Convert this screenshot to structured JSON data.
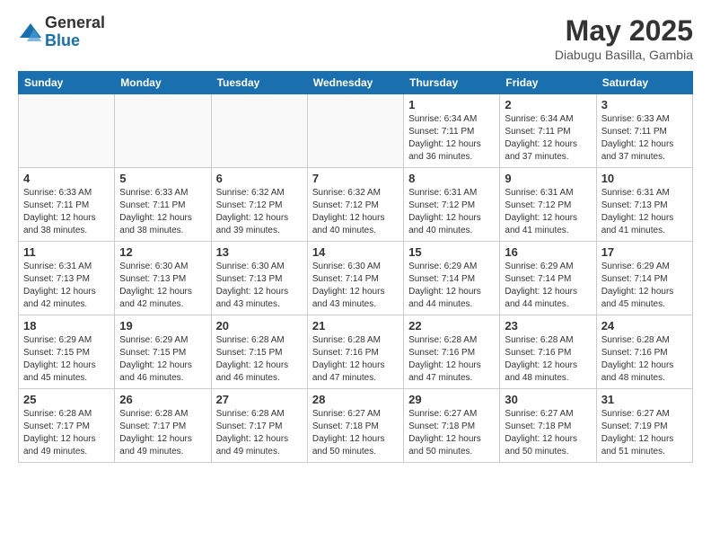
{
  "logo": {
    "general": "General",
    "blue": "Blue"
  },
  "header": {
    "month": "May 2025",
    "location": "Diabugu Basilla, Gambia"
  },
  "weekdays": [
    "Sunday",
    "Monday",
    "Tuesday",
    "Wednesday",
    "Thursday",
    "Friday",
    "Saturday"
  ],
  "weeks": [
    [
      {
        "day": "",
        "info": ""
      },
      {
        "day": "",
        "info": ""
      },
      {
        "day": "",
        "info": ""
      },
      {
        "day": "",
        "info": ""
      },
      {
        "day": "1",
        "info": "Sunrise: 6:34 AM\nSunset: 7:11 PM\nDaylight: 12 hours\nand 36 minutes."
      },
      {
        "day": "2",
        "info": "Sunrise: 6:34 AM\nSunset: 7:11 PM\nDaylight: 12 hours\nand 37 minutes."
      },
      {
        "day": "3",
        "info": "Sunrise: 6:33 AM\nSunset: 7:11 PM\nDaylight: 12 hours\nand 37 minutes."
      }
    ],
    [
      {
        "day": "4",
        "info": "Sunrise: 6:33 AM\nSunset: 7:11 PM\nDaylight: 12 hours\nand 38 minutes."
      },
      {
        "day": "5",
        "info": "Sunrise: 6:33 AM\nSunset: 7:11 PM\nDaylight: 12 hours\nand 38 minutes."
      },
      {
        "day": "6",
        "info": "Sunrise: 6:32 AM\nSunset: 7:12 PM\nDaylight: 12 hours\nand 39 minutes."
      },
      {
        "day": "7",
        "info": "Sunrise: 6:32 AM\nSunset: 7:12 PM\nDaylight: 12 hours\nand 40 minutes."
      },
      {
        "day": "8",
        "info": "Sunrise: 6:31 AM\nSunset: 7:12 PM\nDaylight: 12 hours\nand 40 minutes."
      },
      {
        "day": "9",
        "info": "Sunrise: 6:31 AM\nSunset: 7:12 PM\nDaylight: 12 hours\nand 41 minutes."
      },
      {
        "day": "10",
        "info": "Sunrise: 6:31 AM\nSunset: 7:13 PM\nDaylight: 12 hours\nand 41 minutes."
      }
    ],
    [
      {
        "day": "11",
        "info": "Sunrise: 6:31 AM\nSunset: 7:13 PM\nDaylight: 12 hours\nand 42 minutes."
      },
      {
        "day": "12",
        "info": "Sunrise: 6:30 AM\nSunset: 7:13 PM\nDaylight: 12 hours\nand 42 minutes."
      },
      {
        "day": "13",
        "info": "Sunrise: 6:30 AM\nSunset: 7:13 PM\nDaylight: 12 hours\nand 43 minutes."
      },
      {
        "day": "14",
        "info": "Sunrise: 6:30 AM\nSunset: 7:14 PM\nDaylight: 12 hours\nand 43 minutes."
      },
      {
        "day": "15",
        "info": "Sunrise: 6:29 AM\nSunset: 7:14 PM\nDaylight: 12 hours\nand 44 minutes."
      },
      {
        "day": "16",
        "info": "Sunrise: 6:29 AM\nSunset: 7:14 PM\nDaylight: 12 hours\nand 44 minutes."
      },
      {
        "day": "17",
        "info": "Sunrise: 6:29 AM\nSunset: 7:14 PM\nDaylight: 12 hours\nand 45 minutes."
      }
    ],
    [
      {
        "day": "18",
        "info": "Sunrise: 6:29 AM\nSunset: 7:15 PM\nDaylight: 12 hours\nand 45 minutes."
      },
      {
        "day": "19",
        "info": "Sunrise: 6:29 AM\nSunset: 7:15 PM\nDaylight: 12 hours\nand 46 minutes."
      },
      {
        "day": "20",
        "info": "Sunrise: 6:28 AM\nSunset: 7:15 PM\nDaylight: 12 hours\nand 46 minutes."
      },
      {
        "day": "21",
        "info": "Sunrise: 6:28 AM\nSunset: 7:16 PM\nDaylight: 12 hours\nand 47 minutes."
      },
      {
        "day": "22",
        "info": "Sunrise: 6:28 AM\nSunset: 7:16 PM\nDaylight: 12 hours\nand 47 minutes."
      },
      {
        "day": "23",
        "info": "Sunrise: 6:28 AM\nSunset: 7:16 PM\nDaylight: 12 hours\nand 48 minutes."
      },
      {
        "day": "24",
        "info": "Sunrise: 6:28 AM\nSunset: 7:16 PM\nDaylight: 12 hours\nand 48 minutes."
      }
    ],
    [
      {
        "day": "25",
        "info": "Sunrise: 6:28 AM\nSunset: 7:17 PM\nDaylight: 12 hours\nand 49 minutes."
      },
      {
        "day": "26",
        "info": "Sunrise: 6:28 AM\nSunset: 7:17 PM\nDaylight: 12 hours\nand 49 minutes."
      },
      {
        "day": "27",
        "info": "Sunrise: 6:28 AM\nSunset: 7:17 PM\nDaylight: 12 hours\nand 49 minutes."
      },
      {
        "day": "28",
        "info": "Sunrise: 6:27 AM\nSunset: 7:18 PM\nDaylight: 12 hours\nand 50 minutes."
      },
      {
        "day": "29",
        "info": "Sunrise: 6:27 AM\nSunset: 7:18 PM\nDaylight: 12 hours\nand 50 minutes."
      },
      {
        "day": "30",
        "info": "Sunrise: 6:27 AM\nSunset: 7:18 PM\nDaylight: 12 hours\nand 50 minutes."
      },
      {
        "day": "31",
        "info": "Sunrise: 6:27 AM\nSunset: 7:19 PM\nDaylight: 12 hours\nand 51 minutes."
      }
    ]
  ]
}
